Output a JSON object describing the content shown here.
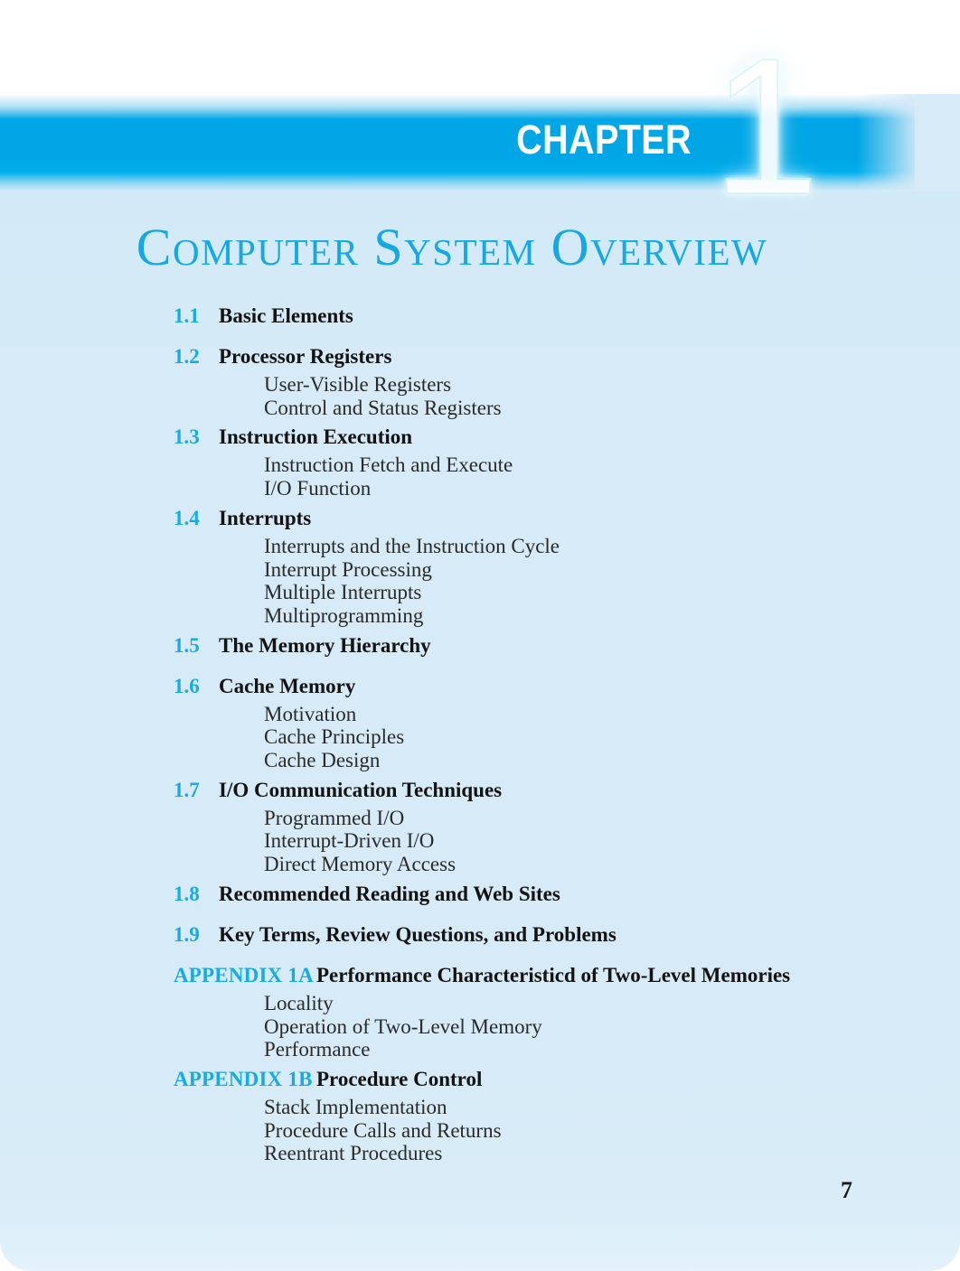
{
  "header": {
    "chapter_label": "CHAPTER",
    "chapter_number": "1"
  },
  "title": "Computer System Overview",
  "colors": {
    "bar_blue": "#00A6E5",
    "title_blue": "#14A9E6",
    "number_blue": "#15ABE6",
    "page_background": "#D6EAF7",
    "body_text": "#131313"
  },
  "folio": "7",
  "toc": [
    {
      "number": "1.1",
      "title": "Basic Elements",
      "subs": []
    },
    {
      "number": "1.2",
      "title": "Processor Registers",
      "subs": [
        "User-Visible Registers",
        "Control and Status Registers"
      ]
    },
    {
      "number": "1.3",
      "title": "Instruction Execution",
      "subs": [
        "Instruction Fetch and Execute",
        "I/O Function"
      ]
    },
    {
      "number": "1.4",
      "title": "Interrupts",
      "subs": [
        "Interrupts and the Instruction Cycle",
        "Interrupt Processing",
        "Multiple Interrupts",
        "Multiprogramming"
      ]
    },
    {
      "number": "1.5",
      "title": "The Memory Hierarchy",
      "subs": []
    },
    {
      "number": "1.6",
      "title": "Cache Memory",
      "subs": [
        "Motivation",
        "Cache Principles",
        "Cache Design"
      ]
    },
    {
      "number": "1.7",
      "title": "I/O Communication Techniques",
      "subs": [
        "Programmed I/O",
        "Interrupt-Driven I/O",
        "Direct Memory Access"
      ]
    },
    {
      "number": "1.8",
      "title": "Recommended Reading and Web Sites",
      "subs": []
    },
    {
      "number": "1.9",
      "title": "Key Terms, Review Questions, and Problems",
      "subs": []
    },
    {
      "number": "APPENDIX 1A",
      "wide": true,
      "title": "Performance Characteristicd of Two-Level Memories",
      "subs": [
        "Locality",
        "Operation of Two-Level Memory",
        "Performance"
      ]
    },
    {
      "number": "APPENDIX 1B",
      "wide": true,
      "title": "Procedure Control",
      "subs": [
        "Stack Implementation",
        "Procedure Calls and Returns",
        "Reentrant Procedures"
      ]
    }
  ]
}
